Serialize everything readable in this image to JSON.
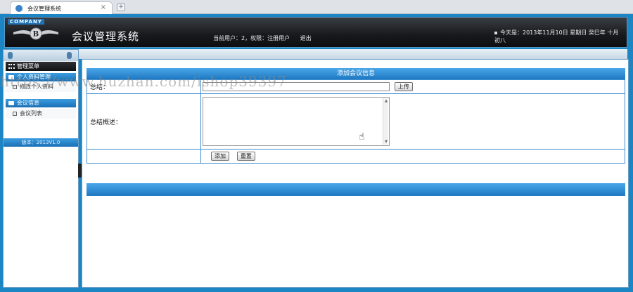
{
  "browser": {
    "tab_title": "会议管理系统",
    "close_glyph": "×",
    "new_tab_glyph": "+"
  },
  "header": {
    "company_badge": "COMPANY",
    "app_title": "会议管理系统",
    "current_user": "当前用户：2，权限：注册用户",
    "logout_label": "退出",
    "date_text": "今天是：2013年11月10日 星期日 癸巳年 十月初八"
  },
  "sidebar": {
    "menu_title": "管理菜单",
    "groups": [
      {
        "label": "个人资料管理",
        "items": [
          {
            "label": "修改个人资料"
          }
        ]
      },
      {
        "label": "会议信息",
        "items": [
          {
            "label": "会议列表"
          }
        ]
      }
    ],
    "version": "版本：2013V1.0"
  },
  "form": {
    "title": "添加会议信息",
    "summary_label": "总结：",
    "upload_button": "上传",
    "description_label": "总结概述：",
    "add_button": "添加",
    "reset_button": "重置"
  },
  "watermark": "https://www.huzhan.com/ishop39397",
  "colors": {
    "frame_blue": "#1c85c4",
    "bar_blue": "#1e78c2",
    "header_dark": "#17191c"
  }
}
